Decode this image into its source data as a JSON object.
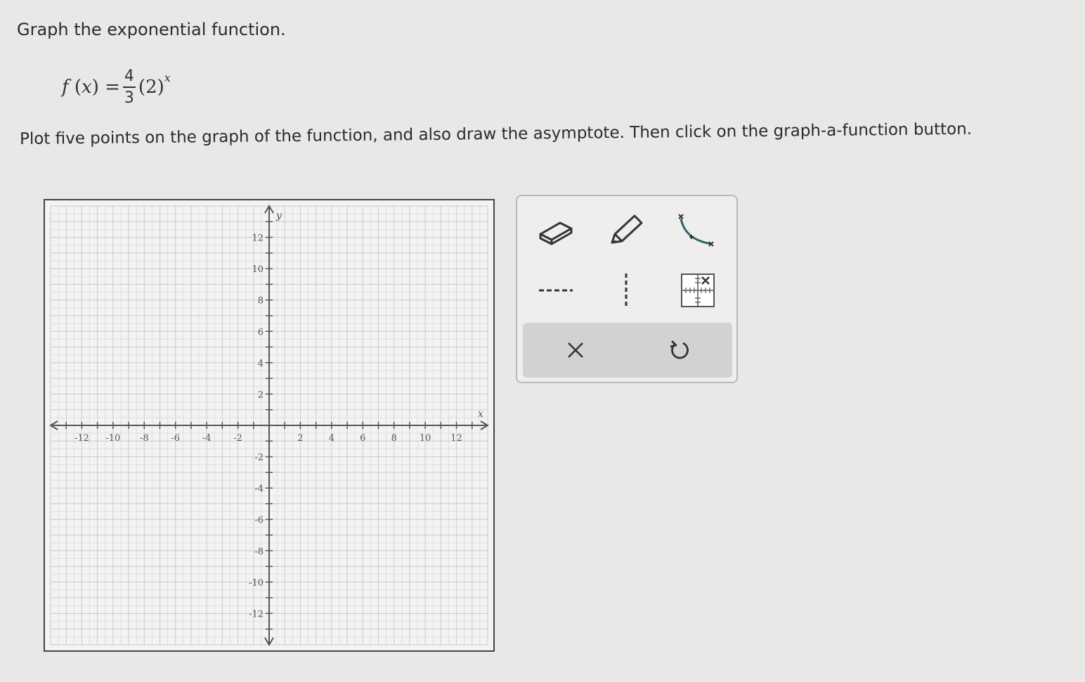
{
  "prompt": "Graph the exponential function.",
  "formula": {
    "fn": "f",
    "var": "x",
    "numerator": "4",
    "denominator": "3",
    "base": "2",
    "exponent": "x"
  },
  "instruction": "Plot five points on the graph of the function, and also draw the asymptote. Then click on the graph-a-function button.",
  "graph": {
    "xmin": -14,
    "xmax": 14,
    "ymin": -14,
    "ymax": 14,
    "x_tick_labels": [
      "-12",
      "-10",
      "-8",
      "-6",
      "-4",
      "-2",
      "2",
      "4",
      "6",
      "8",
      "10",
      "12"
    ],
    "y_tick_labels": [
      "12",
      "10",
      "8",
      "6",
      "4",
      "2",
      "-2",
      "-4",
      "-6",
      "-8",
      "-10",
      "-12"
    ],
    "x_axis_label": "x",
    "y_axis_label": "y",
    "grid": true
  },
  "toolbox": {
    "tools": [
      "eraser-icon",
      "pencil-icon",
      "exponential-curve-icon",
      "horizontal-dashed-line-icon",
      "vertical-dashed-line-icon",
      "graph-function-icon"
    ],
    "actions": {
      "clear": "×",
      "undo": "↺"
    },
    "icon_color": "#2c5e66"
  }
}
